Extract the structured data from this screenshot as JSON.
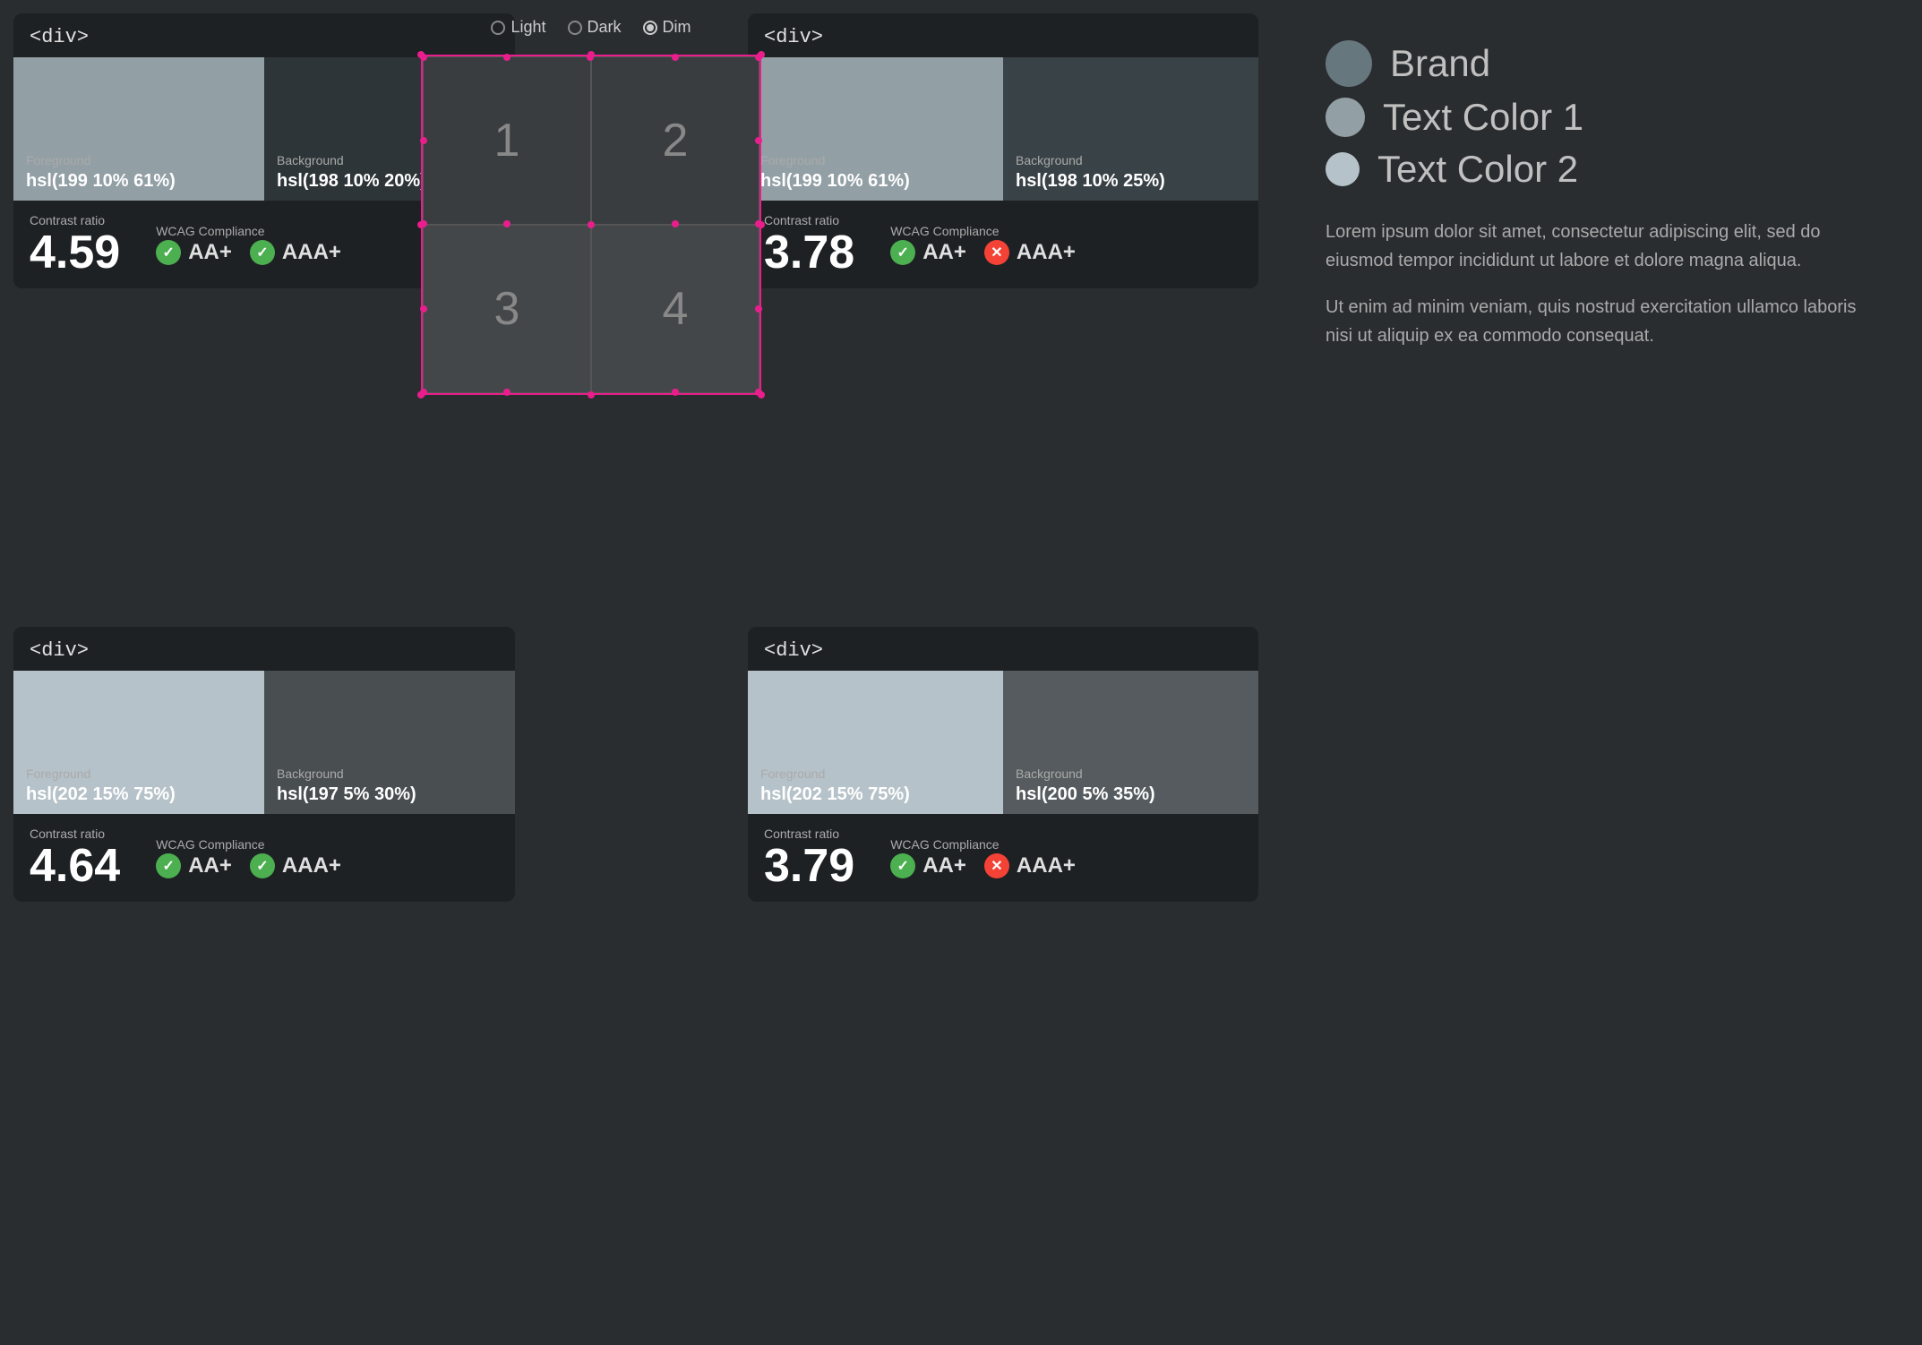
{
  "panels": {
    "topLeft": {
      "title": "<div>",
      "foreground": {
        "label": "Foreground",
        "value": "hsl(199 10% 61%)"
      },
      "background": {
        "label": "Background",
        "value": "hsl(198 10% 20%)"
      },
      "contrastLabel": "Contrast ratio",
      "contrastValue": "4.59",
      "wcagLabel": "WCAG Compliance",
      "wcag": [
        {
          "label": "AA+",
          "pass": true
        },
        {
          "label": "AAA+",
          "pass": true
        }
      ]
    },
    "topRight": {
      "title": "<div>",
      "foreground": {
        "label": "Foreground",
        "value": "hsl(199 10% 61%)"
      },
      "background": {
        "label": "Background",
        "value": "hsl(198 10% 25%)"
      },
      "contrastLabel": "Contrast ratio",
      "contrastValue": "3.78",
      "wcagLabel": "WCAG Compliance",
      "wcag": [
        {
          "label": "AA+",
          "pass": true
        },
        {
          "label": "AAA+",
          "pass": false
        }
      ]
    },
    "bottomLeft": {
      "title": "<div>",
      "foreground": {
        "label": "Foreground",
        "value": "hsl(202 15% 75%)"
      },
      "background": {
        "label": "Background",
        "value": "hsl(197 5% 30%)"
      },
      "contrastLabel": "Contrast ratio",
      "contrastValue": "4.64",
      "wcagLabel": "WCAG Compliance",
      "wcag": [
        {
          "label": "AA+",
          "pass": true
        },
        {
          "label": "AAA+",
          "pass": true
        }
      ]
    },
    "bottomRight": {
      "title": "<div>",
      "foreground": {
        "label": "Foreground",
        "value": "hsl(202 15% 75%)"
      },
      "background": {
        "label": "Background",
        "value": "hsl(200 5% 35%)"
      },
      "contrastLabel": "Contrast ratio",
      "contrastValue": "3.79",
      "wcagLabel": "WCAG Compliance",
      "wcag": [
        {
          "label": "AA+",
          "pass": true
        },
        {
          "label": "AAA+",
          "pass": false
        }
      ]
    }
  },
  "canvas": {
    "gridNumbers": [
      "1",
      "2",
      "3",
      "4"
    ]
  },
  "themeSelector": {
    "options": [
      "Light",
      "Dark",
      "Dim"
    ],
    "selected": "Dim"
  },
  "rightPanel": {
    "legend": [
      {
        "label": "Brand",
        "size": 52
      },
      {
        "label": "Text Color 1",
        "size": 44
      },
      {
        "label": "Text Color 2",
        "size": 38
      }
    ],
    "paragraphs": [
      "Lorem ipsum dolor sit amet, consectetur adipiscing elit, sed do eiusmod tempor incididunt ut labore et dolore magna aliqua.",
      "Ut enim ad minim veniam, quis nostrud exercitation ullamco laboris nisi ut aliquip ex ea commodo consequat."
    ]
  }
}
